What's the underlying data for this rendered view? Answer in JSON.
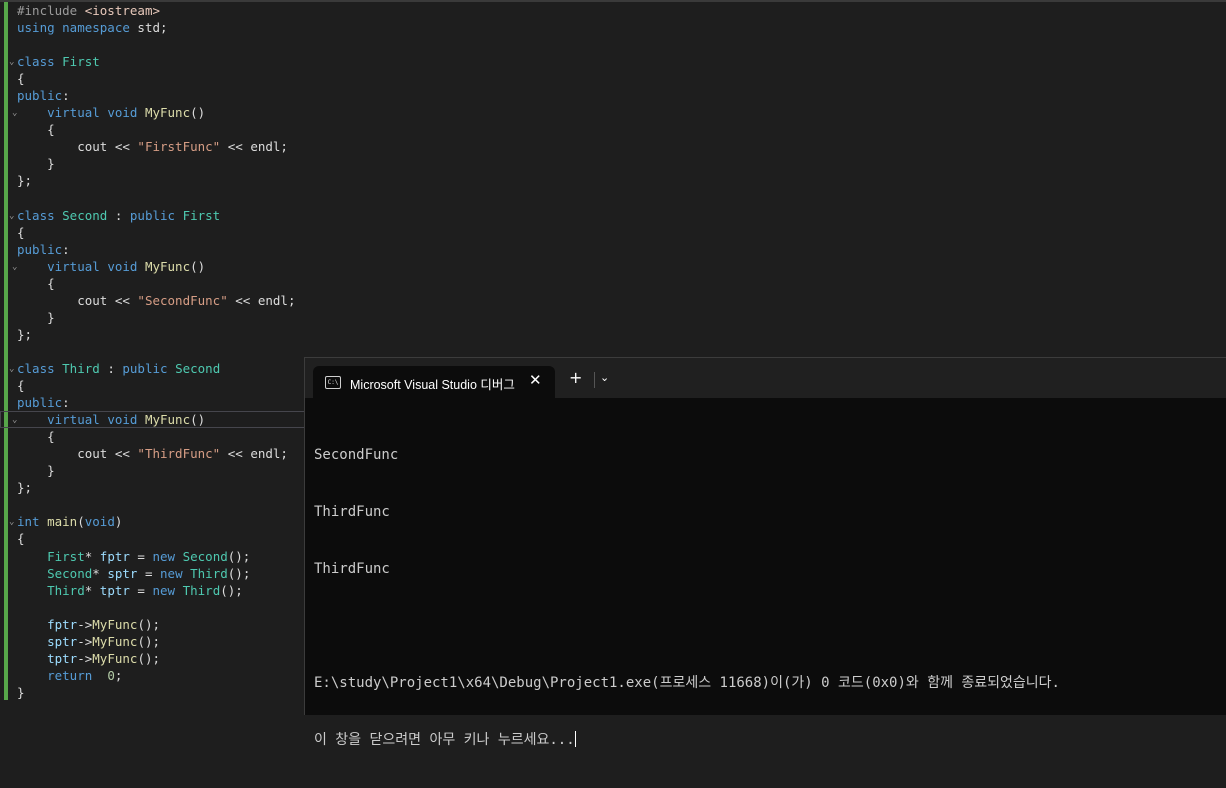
{
  "editor": {
    "lines": [
      [
        {
          "t": "#include ",
          "c": "pp"
        },
        {
          "t": "<iostream>",
          "c": "inc"
        }
      ],
      [
        {
          "t": "using ",
          "c": "kw"
        },
        {
          "t": "namespace ",
          "c": "kw"
        },
        {
          "t": "std;",
          "c": "pl"
        }
      ],
      [],
      [
        {
          "t": "class ",
          "c": "kw"
        },
        {
          "t": "First",
          "c": "ty"
        }
      ],
      [
        {
          "t": "{",
          "c": "pl"
        }
      ],
      [
        {
          "t": "public",
          "c": "kw"
        },
        {
          "t": ":",
          "c": "pl"
        }
      ],
      [
        {
          "t": "    virtual ",
          "c": "kw"
        },
        {
          "t": "void ",
          "c": "kw"
        },
        {
          "t": "MyFunc",
          "c": "fn"
        },
        {
          "t": "()",
          "c": "pl"
        }
      ],
      [
        {
          "t": "    {",
          "c": "pl"
        }
      ],
      [
        {
          "t": "        cout << ",
          "c": "pl"
        },
        {
          "t": "\"FirstFunc\"",
          "c": "st"
        },
        {
          "t": " << endl;",
          "c": "pl"
        }
      ],
      [
        {
          "t": "    }",
          "c": "pl"
        }
      ],
      [
        {
          "t": "};",
          "c": "pl"
        }
      ],
      [],
      [
        {
          "t": "class ",
          "c": "kw"
        },
        {
          "t": "Second",
          "c": "ty"
        },
        {
          "t": " : ",
          "c": "pl"
        },
        {
          "t": "public ",
          "c": "kw"
        },
        {
          "t": "First",
          "c": "ty"
        }
      ],
      [
        {
          "t": "{",
          "c": "pl"
        }
      ],
      [
        {
          "t": "public",
          "c": "kw"
        },
        {
          "t": ":",
          "c": "pl"
        }
      ],
      [
        {
          "t": "    virtual ",
          "c": "kw"
        },
        {
          "t": "void ",
          "c": "kw"
        },
        {
          "t": "MyFunc",
          "c": "fn"
        },
        {
          "t": "()",
          "c": "pl"
        }
      ],
      [
        {
          "t": "    {",
          "c": "pl"
        }
      ],
      [
        {
          "t": "        cout << ",
          "c": "pl"
        },
        {
          "t": "\"SecondFunc\"",
          "c": "st"
        },
        {
          "t": " << endl;",
          "c": "pl"
        }
      ],
      [
        {
          "t": "    }",
          "c": "pl"
        }
      ],
      [
        {
          "t": "};",
          "c": "pl"
        }
      ],
      [],
      [
        {
          "t": "class ",
          "c": "kw"
        },
        {
          "t": "Third",
          "c": "ty"
        },
        {
          "t": " : ",
          "c": "pl"
        },
        {
          "t": "public ",
          "c": "kw"
        },
        {
          "t": "Second",
          "c": "ty"
        }
      ],
      [
        {
          "t": "{",
          "c": "pl"
        }
      ],
      [
        {
          "t": "public",
          "c": "kw"
        },
        {
          "t": ":",
          "c": "pl"
        }
      ],
      [
        {
          "t": "    virtual ",
          "c": "kw"
        },
        {
          "t": "void ",
          "c": "kw"
        },
        {
          "t": "MyFunc",
          "c": "fn"
        },
        {
          "t": "()",
          "c": "pl"
        }
      ],
      [
        {
          "t": "    {",
          "c": "pl"
        }
      ],
      [
        {
          "t": "        cout << ",
          "c": "pl"
        },
        {
          "t": "\"ThirdFunc\"",
          "c": "st"
        },
        {
          "t": " << endl;",
          "c": "pl"
        }
      ],
      [
        {
          "t": "    }",
          "c": "pl"
        }
      ],
      [
        {
          "t": "};",
          "c": "pl"
        }
      ],
      [],
      [
        {
          "t": "int ",
          "c": "kw"
        },
        {
          "t": "main",
          "c": "fn"
        },
        {
          "t": "(",
          "c": "pl"
        },
        {
          "t": "void",
          "c": "kw"
        },
        {
          "t": ")",
          "c": "pl"
        }
      ],
      [
        {
          "t": "{",
          "c": "pl"
        }
      ],
      [
        {
          "t": "    First",
          "c": "ty"
        },
        {
          "t": "* ",
          "c": "pl"
        },
        {
          "t": "fptr",
          "c": "var"
        },
        {
          "t": " = ",
          "c": "pl"
        },
        {
          "t": "new ",
          "c": "kw"
        },
        {
          "t": "Second",
          "c": "ty"
        },
        {
          "t": "();",
          "c": "pl"
        }
      ],
      [
        {
          "t": "    Second",
          "c": "ty"
        },
        {
          "t": "* ",
          "c": "pl"
        },
        {
          "t": "sptr",
          "c": "var"
        },
        {
          "t": " = ",
          "c": "pl"
        },
        {
          "t": "new ",
          "c": "kw"
        },
        {
          "t": "Third",
          "c": "ty"
        },
        {
          "t": "();",
          "c": "pl"
        }
      ],
      [
        {
          "t": "    Third",
          "c": "ty"
        },
        {
          "t": "* ",
          "c": "pl"
        },
        {
          "t": "tptr",
          "c": "var"
        },
        {
          "t": " = ",
          "c": "pl"
        },
        {
          "t": "new ",
          "c": "kw"
        },
        {
          "t": "Third",
          "c": "ty"
        },
        {
          "t": "();",
          "c": "pl"
        }
      ],
      [],
      [
        {
          "t": "    fptr",
          "c": "var"
        },
        {
          "t": "->",
          "c": "pl"
        },
        {
          "t": "MyFunc",
          "c": "fn"
        },
        {
          "t": "();",
          "c": "pl"
        }
      ],
      [
        {
          "t": "    sptr",
          "c": "var"
        },
        {
          "t": "->",
          "c": "pl"
        },
        {
          "t": "MyFunc",
          "c": "fn"
        },
        {
          "t": "();",
          "c": "pl"
        }
      ],
      [
        {
          "t": "    tptr",
          "c": "var"
        },
        {
          "t": "->",
          "c": "pl"
        },
        {
          "t": "MyFunc",
          "c": "fn"
        },
        {
          "t": "();",
          "c": "pl"
        }
      ],
      [
        {
          "t": "    return ",
          "c": "kw"
        },
        {
          "t": " 0",
          "c": "num"
        },
        {
          "t": ";",
          "c": "pl"
        }
      ],
      [
        {
          "t": "}",
          "c": "pl"
        }
      ]
    ]
  },
  "terminal": {
    "tab_title": "Microsoft Visual Studio 디버그",
    "tab_icon_text": "C:\\",
    "close_glyph": "✕",
    "new_tab_glyph": "+",
    "dropdown_glyph": "⌄",
    "output_lines": [
      "SecondFunc",
      "ThirdFunc",
      "ThirdFunc",
      "",
      "E:\\study\\Project1\\x64\\Debug\\Project1.exe(프로세스 11668)이(가) 0 코드(0x0)와 함께 종료되었습니다.",
      "이 창을 닫으려면 아무 키나 누르세요..."
    ]
  }
}
